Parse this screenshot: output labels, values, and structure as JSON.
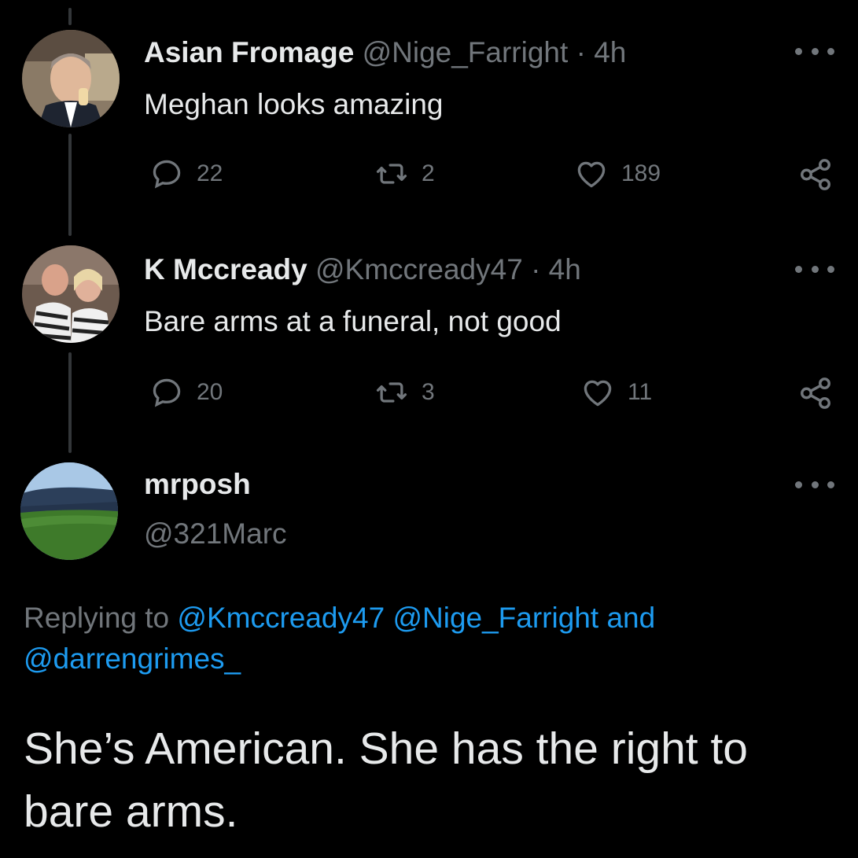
{
  "tweets": [
    {
      "display_name": "Asian Fromage",
      "handle": "@Nige_Farright",
      "separator": "·",
      "time": "4h",
      "text": "Meghan looks amazing",
      "replies": "22",
      "retweets": "2",
      "likes": "189"
    },
    {
      "display_name": "K Mccready",
      "handle": "@Kmccready47",
      "separator": "·",
      "time": "4h",
      "text": "Bare arms at a funeral, not good",
      "replies": "20",
      "retweets": "3",
      "likes": "11"
    }
  ],
  "reply": {
    "display_name": "mrposh",
    "handle": "@321Marc",
    "replying_prefix": "Replying to",
    "mention_1": "@Kmccready47",
    "mention_2": "@Nige_Farright",
    "mention_and": "and",
    "mention_3": "@darrengrimes_",
    "text": "She’s American. She has the right to bare arms."
  },
  "icons": {
    "reply": "speech-bubble-icon",
    "retweet": "retweet-icon",
    "like": "heart-icon",
    "share": "share-icon",
    "more": "more-dots-icon"
  },
  "colors": {
    "background": "#000000",
    "text": "#e7e9ea",
    "secondary": "#71767b",
    "link": "#1d9bf0"
  }
}
